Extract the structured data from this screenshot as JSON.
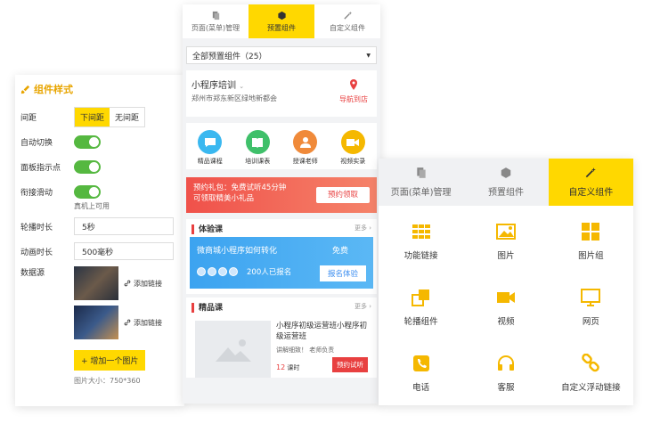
{
  "left": {
    "title": "组件样式",
    "spacing_label": "间距",
    "spacing_options": [
      "下间距",
      "无间距"
    ],
    "autoswitch_label": "自动切换",
    "indicator_label": "面板指示点",
    "seamless_label": "衔接滑动",
    "seamless_hint": "真机上可用",
    "duration_label": "轮播时长",
    "duration_value": "5秒",
    "anim_label": "动画时长",
    "anim_value": "500毫秒",
    "datasource_label": "数据源",
    "add_link_1": "添加链接",
    "add_link_2": "添加链接",
    "add_image_button": "增加一个图片",
    "image_size_note": "图片大小：750*360"
  },
  "mid": {
    "tabs": [
      "页面(菜单)管理",
      "预置组件",
      "自定义组件"
    ],
    "dropdown": "全部预置组件（25）",
    "shop_name": "小程序培训",
    "shop_address": "郑州市郑东新区绿地新都会",
    "nav_label": "导航到店",
    "icons": [
      "精品课程",
      "培训课表",
      "授课老师",
      "视频实录"
    ],
    "promo_line1": "预约礼包：免费试听45分钟",
    "promo_line2": "可领取精美小礼品",
    "promo_button": "预约领取",
    "section1": "体验课",
    "more1": "更多",
    "blue_title": "微商城小程序如何转化",
    "blue_free": "免费",
    "blue_count": "200人已报名",
    "blue_button": "报名体验",
    "section2": "精品课",
    "more2": "更多",
    "course_title": "小程序初级运营班小程序初级运营班",
    "course_sub": "讲解细致！ 老师负责",
    "course_count_num": "12",
    "course_count_unit": "课时",
    "course_button": "预约试听"
  },
  "right": {
    "tabs": [
      "页面(菜单)管理",
      "预置组件",
      "自定义组件"
    ],
    "cells": [
      "功能链接",
      "图片",
      "图片组",
      "轮播组件",
      "视频",
      "网页",
      "电话",
      "客服",
      "自定义浮动链接"
    ]
  },
  "colors": {
    "accent": "#ffd800",
    "red": "#e84040",
    "green": "#55b840",
    "blue": "#3ca3f0"
  }
}
